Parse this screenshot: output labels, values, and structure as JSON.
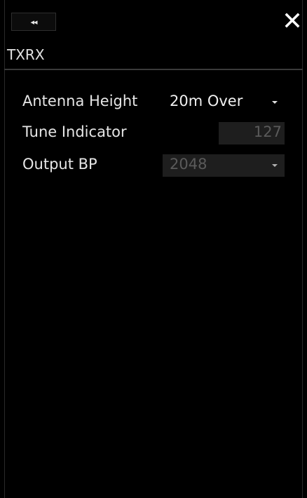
{
  "toolbar": {
    "collapse_glyph": "◂◂",
    "close_icon": "close-icon"
  },
  "panel": {
    "title": "TXRX"
  },
  "settings": {
    "antenna_height": {
      "label": "Antenna Height",
      "value": "20m Over"
    },
    "tune_indicator": {
      "label": "Tune Indicator",
      "value": "127"
    },
    "output_bp": {
      "label": "Output BP",
      "value": "2048"
    }
  },
  "colors": {
    "background": "#000000",
    "text": "#e6e6e6",
    "disabled_field": "#1e1e1e",
    "disabled_text": "#5a5a5a"
  }
}
